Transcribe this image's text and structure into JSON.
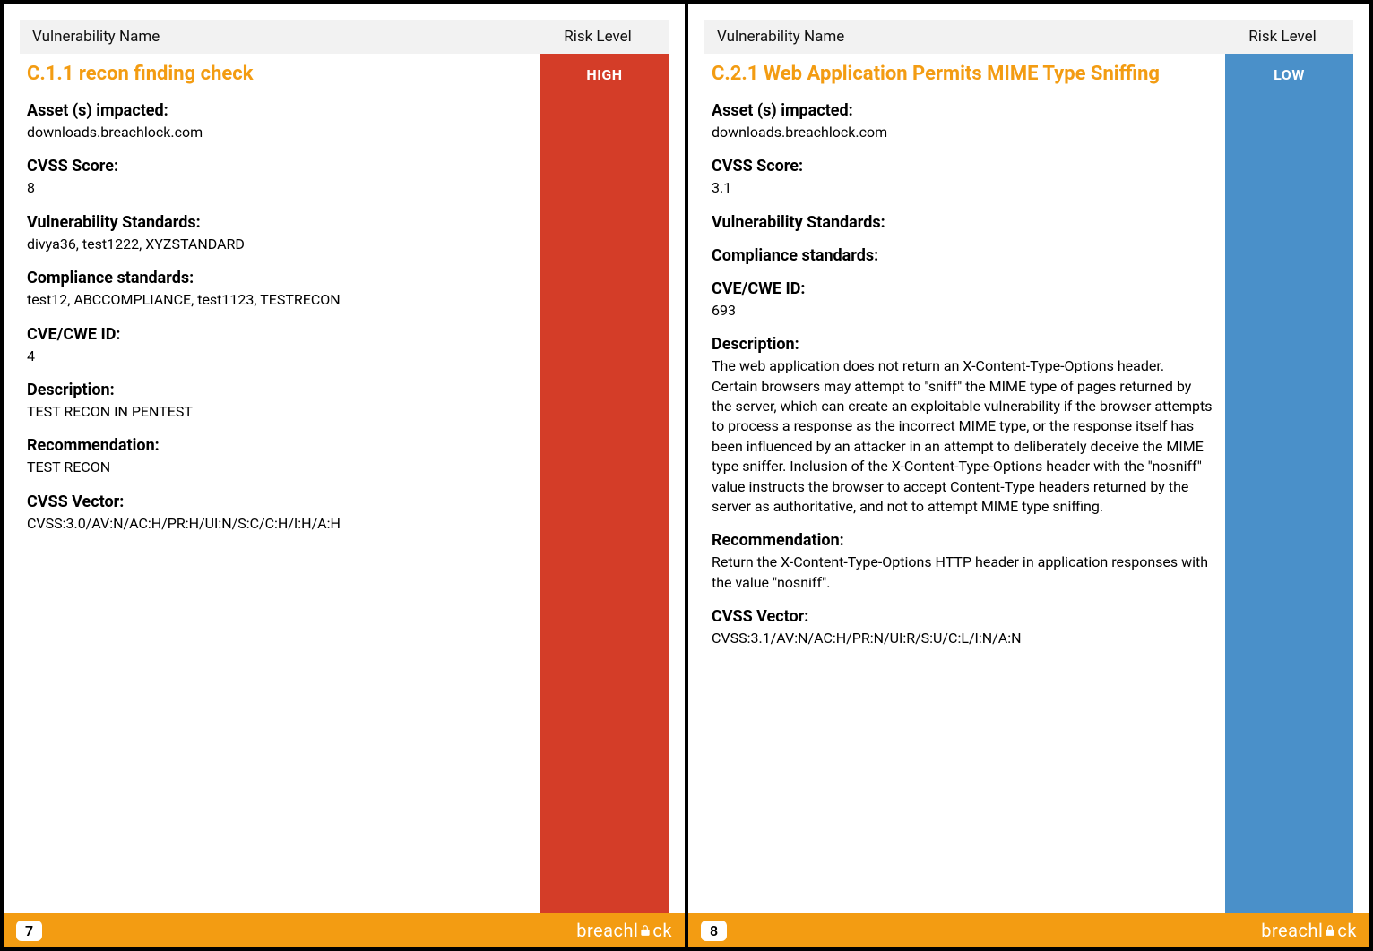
{
  "headers": {
    "name": "Vulnerability Name",
    "risk": "Risk Level"
  },
  "sections": {
    "asset": "Asset (s) impacted:",
    "cvss": "CVSS Score:",
    "vuln_std": "Vulnerability Standards:",
    "comp_std": "Compliance standards:",
    "cve": "CVE/CWE ID:",
    "desc": "Description:",
    "rec": "Recommendation:",
    "vector": "CVSS Vector:"
  },
  "risk_labels": {
    "high": "HIGH",
    "low": "LOW"
  },
  "brand": "breachl  ck",
  "pages": [
    {
      "number": "7",
      "title": "C.1.1 recon finding check",
      "risk": "high",
      "asset": "downloads.breachlock.com",
      "cvss_score": "8",
      "vuln_standards": "divya36, test1222, XYZSTANDARD",
      "compliance": "test12, ABCCOMPLIANCE, test1123, TESTRECON",
      "cve_id": "4",
      "description": "TEST RECON IN PENTEST",
      "recommendation": "TEST RECON",
      "cvss_vector": "CVSS:3.0/AV:N/AC:H/PR:H/UI:N/S:C/C:H/I:H/A:H"
    },
    {
      "number": "8",
      "title": "C.2.1 Web Application Permits MIME Type Sniffing",
      "risk": "low",
      "asset": "downloads.breachlock.com",
      "cvss_score": "3.1",
      "vuln_standards": "",
      "compliance": "",
      "cve_id": "693",
      "description": "The web application does not return an X-Content-Type-Options header. Certain browsers may attempt to \"sniff\" the MIME type of pages returned by the server, which can create an exploitable vulnerability if the browser attempts to process a response as the incorrect MIME type, or the response itself has been influenced by an attacker in an attempt to deliberately deceive the MIME type sniffer. Inclusion of the X-Content-Type-Options header with the \"nosniff\" value instructs the browser to accept Content-Type headers returned by the server as authoritative, and not to attempt MIME type sniffing.",
      "recommendation": "Return the X-Content-Type-Options HTTP header in application responses with the value \"nosniff\".",
      "cvss_vector": "CVSS:3.1/AV:N/AC:H/PR:N/UI:R/S:U/C:L/I:N/A:N"
    }
  ]
}
